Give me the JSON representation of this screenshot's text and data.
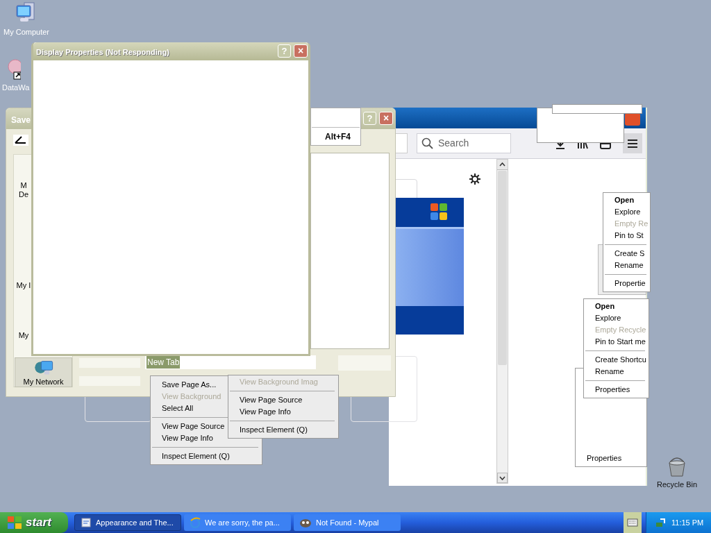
{
  "desktop_icons": [
    {
      "label": "My Computer"
    },
    {
      "label": "DataWa"
    },
    {
      "label": "Recycle Bin"
    }
  ],
  "save_dialog": {
    "title": "Save",
    "places": [
      {
        "lines": [
          "M",
          "De"
        ],
        "selected": false
      },
      {
        "lines": [
          "My I"
        ],
        "selected": false
      },
      {
        "lines": [
          "My"
        ],
        "selected": false
      },
      {
        "lines": [
          "My Network"
        ],
        "selected": true
      }
    ],
    "shortcut_hint": "Alt+F4",
    "file_name": "New Tab",
    "title_buttons": [
      "?",
      "×"
    ]
  },
  "browser": {
    "search": {
      "placeholder": "Search"
    }
  },
  "display_properties": {
    "title": "Display Properties (Not Responding)",
    "title_buttons": [
      "?",
      "×"
    ]
  },
  "context_menus": [
    {
      "items": [
        {
          "kind": "item",
          "label": "Open",
          "bold": true,
          "disabled": false
        },
        {
          "kind": "item",
          "label": "Explore",
          "bold": false,
          "disabled": false
        },
        {
          "kind": "item",
          "label": "Empty Re",
          "bold": false,
          "disabled": true
        },
        {
          "kind": "item",
          "label": "Pin to St",
          "bold": false,
          "disabled": false
        },
        {
          "kind": "separator"
        },
        {
          "kind": "item",
          "label": "Create S",
          "bold": false,
          "disabled": false
        },
        {
          "kind": "item",
          "label": "Rename",
          "bold": false,
          "disabled": false
        },
        {
          "kind": "separator"
        },
        {
          "kind": "item",
          "label": "Propertie",
          "bold": false,
          "disabled": false
        }
      ]
    },
    {
      "items": [
        {
          "kind": "item",
          "label": "Open",
          "bold": true,
          "disabled": false
        },
        {
          "kind": "item",
          "label": "Explore",
          "bold": false,
          "disabled": false
        },
        {
          "kind": "item",
          "label": "Empty Recycle",
          "bold": false,
          "disabled": true
        },
        {
          "kind": "item",
          "label": "Pin to Start me",
          "bold": false,
          "disabled": false
        },
        {
          "kind": "separator"
        },
        {
          "kind": "item",
          "label": "Create Shortcu",
          "bold": false,
          "disabled": false
        },
        {
          "kind": "item",
          "label": "Rename",
          "bold": false,
          "disabled": false
        },
        {
          "kind": "separator"
        },
        {
          "kind": "item",
          "label": "Properties",
          "bold": false,
          "disabled": false
        }
      ]
    },
    {
      "items": [
        {
          "kind": "item",
          "label": "Save Page As...",
          "bold": false,
          "disabled": false
        },
        {
          "kind": "item",
          "label": "View Background",
          "bold": false,
          "disabled": true
        },
        {
          "kind": "item",
          "label": "Select All",
          "bold": false,
          "disabled": false
        },
        {
          "kind": "separator"
        },
        {
          "kind": "item",
          "label": "View Page Source",
          "bold": false,
          "disabled": false
        },
        {
          "kind": "item",
          "label": "View Page Info",
          "bold": false,
          "disabled": false
        },
        {
          "kind": "separator"
        },
        {
          "kind": "item",
          "label": "Inspect Element (Q)",
          "bold": false,
          "disabled": false
        }
      ]
    },
    {
      "items": [
        {
          "kind": "item",
          "label": "View Background Imag",
          "bold": false,
          "disabled": true
        },
        {
          "kind": "separator"
        },
        {
          "kind": "item",
          "label": "View Page Source",
          "bold": false,
          "disabled": false
        },
        {
          "kind": "item",
          "label": "View Page Info",
          "bold": false,
          "disabled": false
        },
        {
          "kind": "separator"
        },
        {
          "kind": "item",
          "label": "Inspect Element (Q)",
          "bold": false,
          "disabled": false
        }
      ]
    },
    {
      "items": [
        {
          "kind": "item",
          "label": "Properties",
          "bold": false,
          "disabled": false
        }
      ]
    }
  ],
  "taskbar": {
    "start": "start",
    "tasks": [
      {
        "label": "Appearance and The...",
        "selected": true
      },
      {
        "label": "We are sorry, the pa...",
        "selected": false
      },
      {
        "label": "Not Found - Mypal",
        "selected": false
      }
    ],
    "clock": "11:15 PM"
  }
}
